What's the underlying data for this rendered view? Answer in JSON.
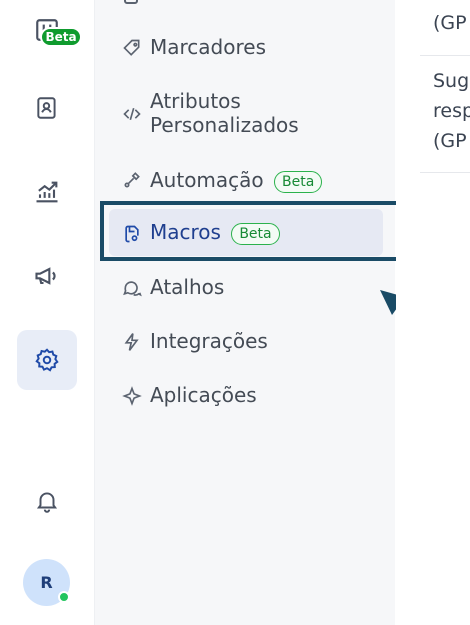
{
  "rail": {
    "beta_badge": "Beta",
    "avatar_initial": "R"
  },
  "menu": {
    "items": [
      {
        "label": "Marcadores",
        "icon": "tag-icon"
      },
      {
        "label": "Atributos\nPersonalizados",
        "icon": "code-icon"
      },
      {
        "label": "Automação",
        "icon": "automation-icon",
        "badge": "Beta"
      },
      {
        "label": "Macros",
        "icon": "macro-icon",
        "badge": "Beta",
        "active": true
      },
      {
        "label": "Atalhos",
        "icon": "chat-bubbles-icon"
      },
      {
        "label": "Integrações",
        "icon": "bolt-icon"
      },
      {
        "label": "Aplicações",
        "icon": "sparkle-icon"
      }
    ]
  },
  "content": {
    "line1": "(GP",
    "line2": "Sug",
    "line3": "resp",
    "line4": "(GP"
  },
  "colors": {
    "accent": "#1f4aa8",
    "highlight_border": "#1a4b66",
    "badge_green": "#0f9b2e"
  }
}
